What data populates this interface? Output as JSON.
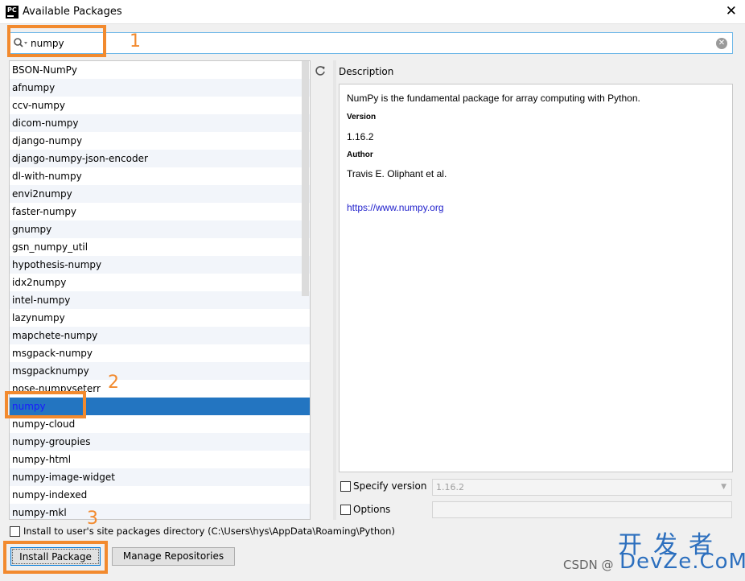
{
  "window": {
    "title": "Available Packages",
    "app_icon_label": "PC",
    "close_glyph": "✕"
  },
  "search": {
    "value": "numpy",
    "clear_glyph": "✕"
  },
  "packages": [
    "BSON-NumPy",
    "afnumpy",
    "ccv-numpy",
    "dicom-numpy",
    "django-numpy",
    "django-numpy-json-encoder",
    "dl-with-numpy",
    "envi2numpy",
    "faster-numpy",
    "gnumpy",
    "gsn_numpy_util",
    "hypothesis-numpy",
    "idx2numpy",
    "intel-numpy",
    "lazynumpy",
    "mapchete-numpy",
    "msgpack-numpy",
    "msgpacknumpy",
    "nose-numpyseterr",
    "numpy",
    "numpy-cloud",
    "numpy-groupies",
    "numpy-html",
    "numpy-image-widget",
    "numpy-indexed",
    "numpy-mkl"
  ],
  "selected_package": "numpy",
  "description": {
    "label": "Description",
    "summary": "NumPy is the fundamental package for array computing with Python.",
    "version_heading": "Version",
    "version_value": "1.16.2",
    "author_heading": "Author",
    "author_value": "Travis E. Oliphant et al.",
    "link": "https://www.numpy.org"
  },
  "options": {
    "specify_version_label": "Specify version",
    "specify_version_value": "1.16.2",
    "options_label": "Options",
    "install_user_label": "Install to user's site packages directory (C:\\Users\\hys\\AppData\\Roaming\\Python)"
  },
  "buttons": {
    "install": "Install Package",
    "manage": "Manage Repositories"
  },
  "annotations": {
    "one": "1",
    "two": "2",
    "three": "3",
    "color": "#f28a2e"
  },
  "watermark": {
    "cn": "开发者",
    "csdn": "CSDN @",
    "devze": "DevZe.CoM"
  },
  "colors": {
    "selection": "#2375c1",
    "link": "#2222cc",
    "search_border": "#6fb8e8"
  }
}
